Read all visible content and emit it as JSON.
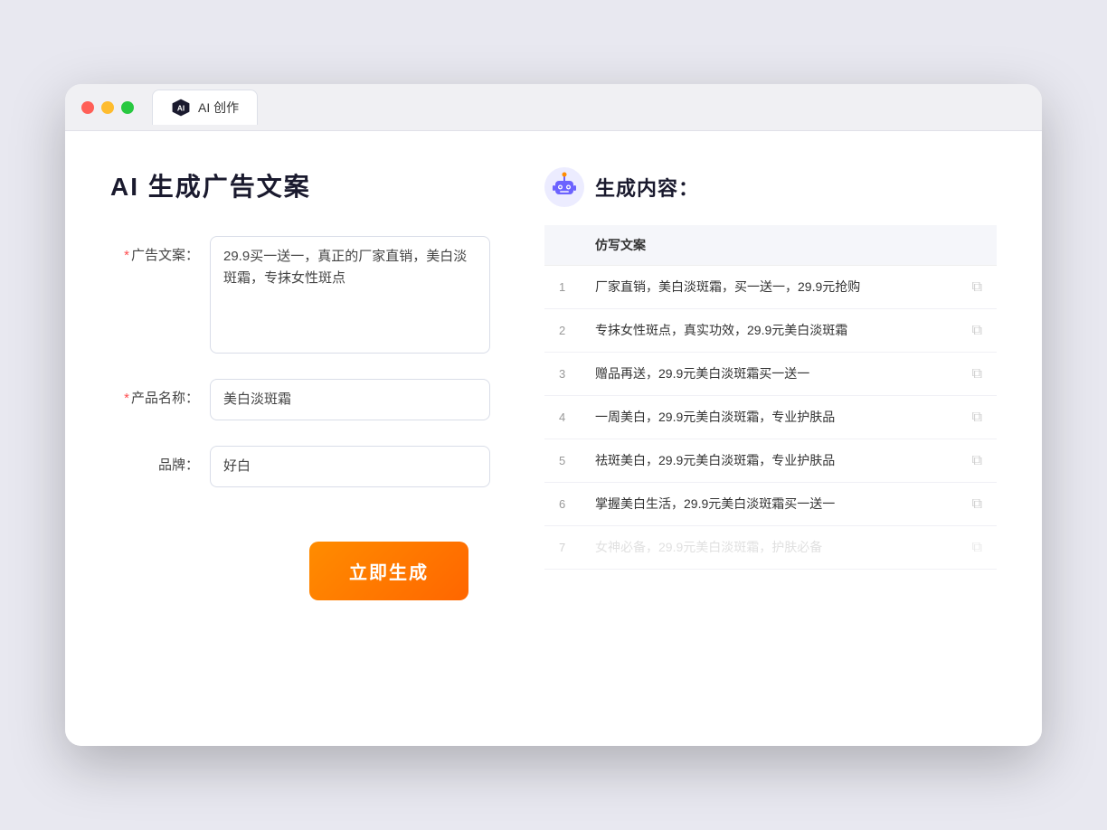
{
  "window": {
    "tab_label": "AI 创作",
    "traffic_lights": [
      "red",
      "yellow",
      "green"
    ]
  },
  "left_panel": {
    "title": "AI 生成广告文案",
    "form": {
      "ad_copy_label": "广告文案：",
      "ad_copy_required": "*",
      "ad_copy_value": "29.9买一送一，真正的厂家直销，美白淡斑霜，专抹女性斑点",
      "product_name_label": "产品名称：",
      "product_name_required": "*",
      "product_name_value": "美白淡斑霜",
      "brand_label": "品牌：",
      "brand_value": "好白"
    },
    "generate_btn_label": "立即生成"
  },
  "right_panel": {
    "title": "生成内容：",
    "table_header": "仿写文案",
    "results": [
      {
        "num": "1",
        "text": "厂家直销，美白淡斑霜，买一送一，29.9元抢购",
        "faded": false
      },
      {
        "num": "2",
        "text": "专抹女性斑点，真实功效，29.9元美白淡斑霜",
        "faded": false
      },
      {
        "num": "3",
        "text": "赠品再送，29.9元美白淡斑霜买一送一",
        "faded": false
      },
      {
        "num": "4",
        "text": "一周美白，29.9元美白淡斑霜，专业护肤品",
        "faded": false
      },
      {
        "num": "5",
        "text": "祛斑美白，29.9元美白淡斑霜，专业护肤品",
        "faded": false
      },
      {
        "num": "6",
        "text": "掌握美白生活，29.9元美白淡斑霜买一送一",
        "faded": false
      },
      {
        "num": "7",
        "text": "女神必备，29.9元美白淡斑霜，护肤必备",
        "faded": true
      }
    ]
  }
}
